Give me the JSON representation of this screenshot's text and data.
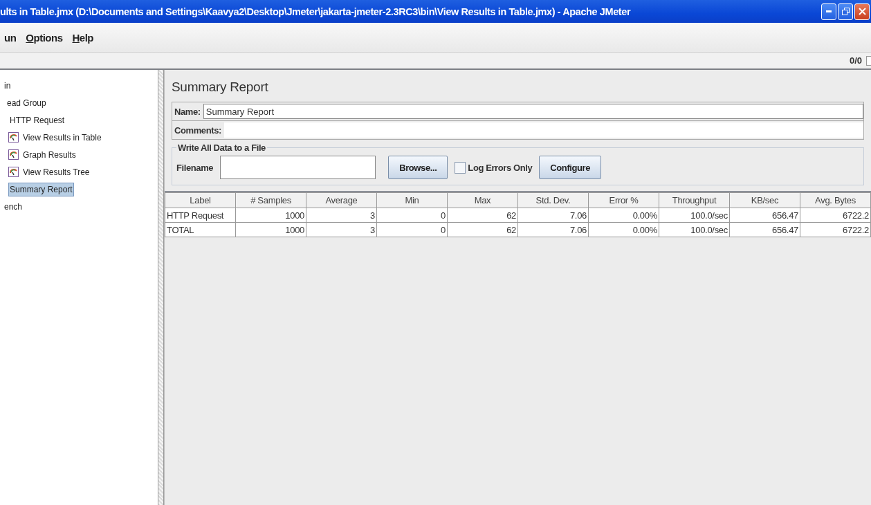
{
  "window": {
    "title": "ults in Table.jmx (D:\\Documents and Settings\\Kaavya2\\Desktop\\Jmeter\\jakarta-jmeter-2.3RC3\\bin\\View Results in Table.jmx) - Apache JMeter"
  },
  "menu": [
    {
      "label": "un",
      "underline_first": false
    },
    {
      "label": "Options",
      "underline_first": true
    },
    {
      "label": "Help",
      "underline_first": true
    }
  ],
  "toolbar": {
    "counter": "0/0"
  },
  "tree": [
    {
      "label": "in",
      "selected": false,
      "children": [
        {
          "label": "ead Group",
          "selected": false,
          "children": [
            {
              "label": "HTTP Request",
              "selected": false
            },
            {
              "label": "View Results in Table",
              "kind": "listener",
              "selected": false
            },
            {
              "label": "Graph Results",
              "kind": "listener",
              "selected": false
            },
            {
              "label": "View Results Tree",
              "kind": "listener",
              "selected": false
            },
            {
              "label": "Summary Report",
              "selected": true
            }
          ]
        }
      ]
    },
    {
      "label": "ench",
      "selected": false
    }
  ],
  "panel": {
    "title": "Summary Report",
    "name_label": "Name:",
    "name_value": "Summary Report",
    "comments_label": "Comments:",
    "file_group": {
      "title": "Write All Data to a File",
      "filename_label": "Filename",
      "browse": "Browse...",
      "log_errors": {
        "label": "Log Errors Only",
        "checked": false
      },
      "configure": "Configure"
    }
  },
  "table": {
    "columns": [
      "Label",
      "# Samples",
      "Average",
      "Min",
      "Max",
      "Std. Dev.",
      "Error %",
      "Throughput",
      "KB/sec",
      "Avg. Bytes"
    ],
    "rows": [
      [
        "HTTP Request",
        "1000",
        "3",
        "0",
        "62",
        "7.06",
        "0.00%",
        "100.0/sec",
        "656.47",
        "6722.2"
      ],
      [
        "TOTAL",
        "1000",
        "3",
        "0",
        "62",
        "7.06",
        "0.00%",
        "100.0/sec",
        "656.47",
        "6722.2"
      ]
    ]
  }
}
